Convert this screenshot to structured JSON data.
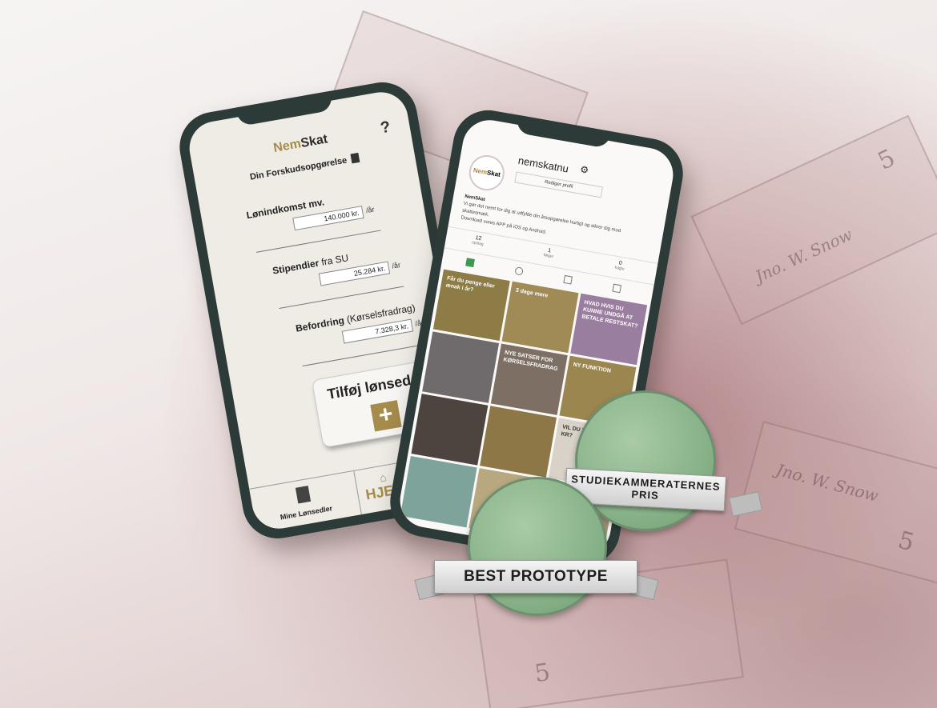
{
  "left_phone": {
    "brand_nem": "Nem",
    "brand_skat": "Skat",
    "help": "?",
    "subtitle": "Din Forskudsopgørelse",
    "fields": [
      {
        "label": "Lønindkomst mv.",
        "label_light": "",
        "value": "140.000 kr.",
        "unit": "/år"
      },
      {
        "label": "Stipendier",
        "label_light": " fra SU",
        "value": "25.284 kr.",
        "unit": "/år"
      },
      {
        "label": "Befordring",
        "label_light": " (Kørselsfradrag)",
        "value": "7.328,3 kr.",
        "unit": "/år"
      }
    ],
    "add_label": "Tilføj lønseddel",
    "add_plus": "+",
    "tab_left_label": "Mine Lønsedler",
    "tab_home_label": "HJEM"
  },
  "right_phone": {
    "avatar_nem": "Nem",
    "avatar_skat": "Skat",
    "username": "nemskatnu",
    "edit_profile": "Rediger profil",
    "bio_name": "NemSkat",
    "bio_text": "Vi gør det nemt for dig at udfylde din årsopgørelse hurtigt og sikrer dig mod skattesmæk.",
    "bio_download": "Download vores APP på iOS og Android.",
    "stats": [
      {
        "value": "12",
        "label": "opslag"
      },
      {
        "value": "1",
        "label": "følger"
      },
      {
        "value": "0",
        "label": "fulgte"
      }
    ],
    "tiles": [
      {
        "text": "Får du penge eller ænak i år?",
        "color": "#8d7c45"
      },
      {
        "text": "3 dage mere",
        "color": "#a08a55"
      },
      {
        "text": "HVAD HVIS DU KUNNE UNDGÅ AT BETALE RESTSKAT?",
        "color": "#9a7ea0"
      },
      {
        "text": "",
        "color": "#6f6a6b"
      },
      {
        "text": "NYE SATSER FOR KØRSELSFRADRAG",
        "color": "#7d6f63"
      },
      {
        "text": "NY FUNKTION",
        "color": "#9b8650"
      },
      {
        "text": "",
        "color": "#4d4440"
      },
      {
        "text": "",
        "color": "#8e7747"
      },
      {
        "text": "VIL DU VINDE 10.000 KR?",
        "color": "#d8d2c8"
      },
      {
        "text": "",
        "color": "#7ea39a"
      },
      {
        "text": "",
        "color": "#b7a880"
      },
      {
        "text": "",
        "color": "#a99a74"
      }
    ]
  },
  "badges": {
    "best_prototype": "BEST PROTOTYPE",
    "student_award_line1": "STUDIEKAMMERATERNES",
    "student_award_line2": "PRIS"
  },
  "background": {
    "bill_numeral": "5",
    "bill_signature": "Jno. W. Snow"
  },
  "colors": {
    "brand_gold": "#a58c4c",
    "phone_body": "#2d3b38",
    "medal_green": "#83ae84"
  }
}
